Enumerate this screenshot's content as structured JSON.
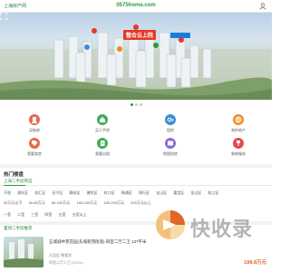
{
  "header": {
    "city": "上海房产网",
    "domain": "0575home.com",
    "user_icon": "user-icon"
  },
  "banner": {
    "slogan": "整合云上院",
    "pin_icon": "map-pin-icon",
    "zoom_icon": "zoom-icon",
    "slides": 3,
    "active_slide": 1
  },
  "categories": [
    {
      "label": "买新房",
      "icon": "building-icon",
      "color": "#e9694a"
    },
    {
      "label": "买二手房",
      "icon": "house-icon",
      "color": "#3fae5a"
    },
    {
      "label": "租房",
      "icon": "key-icon",
      "color": "#3b8fd6"
    },
    {
      "label": "海外地产",
      "icon": "globe-icon",
      "color": "#f08a24"
    },
    {
      "label": "我要卖房",
      "icon": "tag-icon",
      "color": "#e9694a"
    },
    {
      "label": "我要出租",
      "icon": "document-icon",
      "color": "#3fae5a"
    },
    {
      "label": "地图找房",
      "icon": "map-icon",
      "color": "#8b6bd6"
    },
    {
      "label": "装修服务",
      "icon": "brush-icon",
      "color": "#e24b4b"
    }
  ],
  "sections": {
    "hot_title": "热门楼盘",
    "tab_label": "上海二手房筛选"
  },
  "filters": {
    "districts": [
      "不限",
      "浦东区",
      "徐汇区",
      "长宁区",
      "静安区",
      "普陀区",
      "虹口区",
      "杨浦区",
      "闵行区",
      "宝山区",
      "嘉定区",
      "金山区",
      "松江区",
      "青浦区",
      "奉贤区",
      "崇明区"
    ],
    "prices": [
      "50万元以下",
      "50-80万元",
      "80-100万元",
      "100-150万元",
      "150-200万元",
      "200万元以上"
    ],
    "rooms": [
      "一室",
      "二室",
      "三室",
      "四室",
      "五室",
      "五室以上"
    ]
  },
  "listing": {
    "tag": "置顶二手房推荐",
    "title": "五城城中苑花园(东城新苑街道)  四室二厅二卫  137平米",
    "sub": "天涯区  整套房",
    "sub2": "四室二厅二卫  (137m)",
    "price": "198.8万元"
  },
  "watermark": {
    "text": "快收录",
    "icon": "watermark-logo-icon"
  },
  "colors": {
    "brand": "#2a9a3c",
    "price": "#e0662a",
    "slogan_bg": "#e23a26"
  }
}
